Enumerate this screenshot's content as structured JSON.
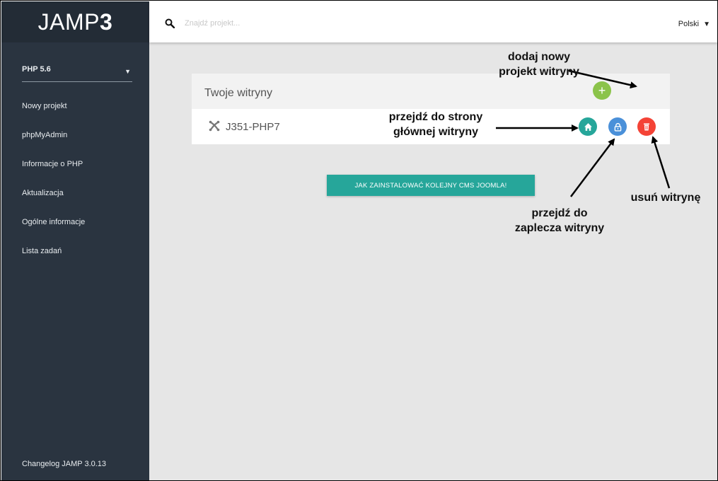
{
  "app": {
    "logo_text": "JAMP",
    "logo_number": "3"
  },
  "sidebar": {
    "php_version": "PHP 5.6",
    "items": [
      {
        "label": "Nowy projekt"
      },
      {
        "label": "phpMyAdmin"
      },
      {
        "label": "Informacje o PHP"
      },
      {
        "label": "Aktualizacja"
      },
      {
        "label": "Ogólne informacje"
      },
      {
        "label": "Lista zadań"
      }
    ],
    "changelog": "Changelog JAMP 3.0.13"
  },
  "topbar": {
    "search_placeholder": "Znajdź projekt...",
    "language": "Polski"
  },
  "main": {
    "card_title": "Twoje witryny",
    "sites": [
      {
        "name": "J351-PHP7",
        "icon": "joomla-icon"
      }
    ],
    "add_button_label": "+",
    "install_button": "JAK ZAINSTALOWAĆ KOLEJNY CMS JOOMLA!"
  },
  "annotations": {
    "add_project": [
      "dodaj nowy",
      "projekt witryny"
    ],
    "go_home": [
      "przejdź do strony",
      "głównej witryny"
    ],
    "go_admin": [
      "przejdź do",
      "zaplecza witryny"
    ],
    "delete": "usuń witrynę"
  },
  "colors": {
    "sidebar": "#2a3440",
    "accent": "#26a69a",
    "add": "#8bc34a",
    "lock": "#4a90d9",
    "delete": "#f44336"
  }
}
